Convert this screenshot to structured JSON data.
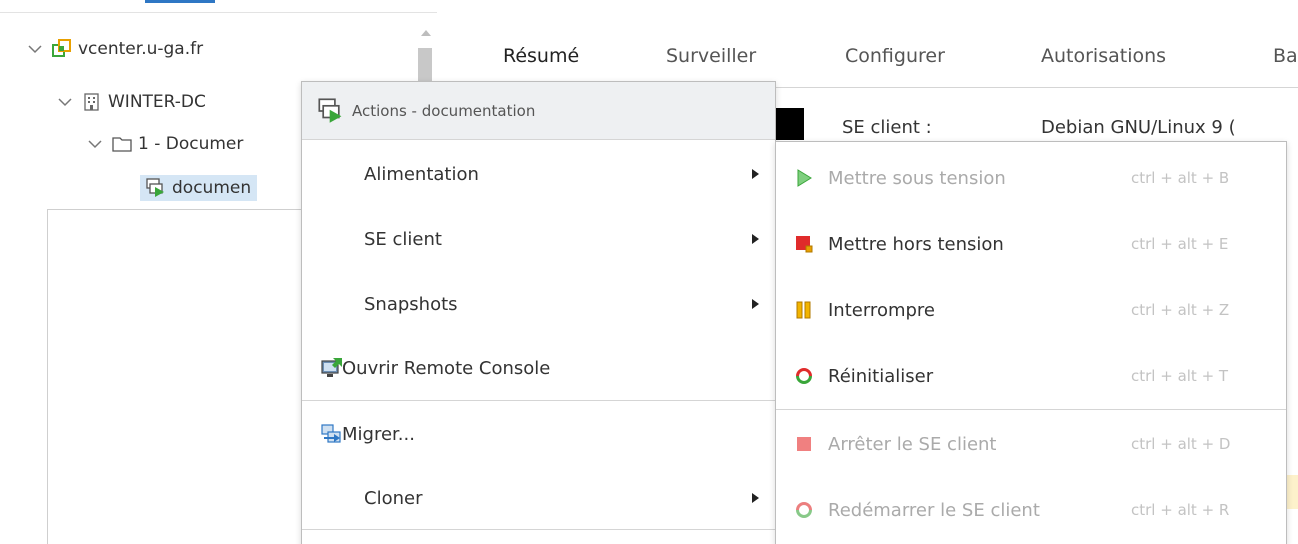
{
  "tree": {
    "items": [
      {
        "label": "vcenter.u-ga.fr",
        "icon": "vcenter-icon"
      },
      {
        "label": "WINTER-DC",
        "icon": "datacenter-icon"
      },
      {
        "label": "1 - Documer",
        "icon": "folder-icon"
      },
      {
        "label": "documen",
        "icon": "vm-icon"
      }
    ]
  },
  "tabs": [
    {
      "label": "Résumé"
    },
    {
      "label": "Surveiller"
    },
    {
      "label": "Configurer"
    },
    {
      "label": "Autorisations"
    },
    {
      "label": "Ba"
    }
  ],
  "summary": {
    "se_client_label": "SE client :",
    "se_client_value": "Debian GNU/Linux 9 ("
  },
  "context_menu": {
    "header": "Actions - documentation",
    "items": [
      {
        "label": "Alimentation",
        "submenu": true
      },
      {
        "label": "SE client",
        "submenu": true
      },
      {
        "label": "Snapshots",
        "submenu": true
      },
      {
        "label": "Ouvrir Remote Console",
        "icon": "remote-console-icon"
      },
      {
        "label": "Migrer...",
        "icon": "migrate-icon"
      },
      {
        "label": "Cloner",
        "submenu": true
      }
    ]
  },
  "power_submenu": {
    "items": [
      {
        "label": "Mettre sous tension",
        "shortcut": "ctrl + alt + B",
        "enabled": false,
        "icon": "power-on-icon"
      },
      {
        "label": "Mettre hors tension",
        "shortcut": "ctrl + alt + E",
        "enabled": true,
        "icon": "power-off-icon"
      },
      {
        "label": "Interrompre",
        "shortcut": "ctrl + alt + Z",
        "enabled": true,
        "icon": "suspend-icon"
      },
      {
        "label": "Réinitialiser",
        "shortcut": "ctrl + alt + T",
        "enabled": true,
        "icon": "reset-icon"
      },
      {
        "label": "Arrêter le SE client",
        "shortcut": "ctrl + alt + D",
        "enabled": false,
        "icon": "shutdown-guest-icon"
      },
      {
        "label": "Redémarrer le SE client",
        "shortcut": "ctrl + alt + R",
        "enabled": false,
        "icon": "restart-guest-icon"
      }
    ]
  },
  "colors": {
    "accent": "#2f77c4",
    "power_on_green": "#3aa63a",
    "power_off_red": "#e02b2b",
    "suspend_orange": "#e8a000"
  }
}
